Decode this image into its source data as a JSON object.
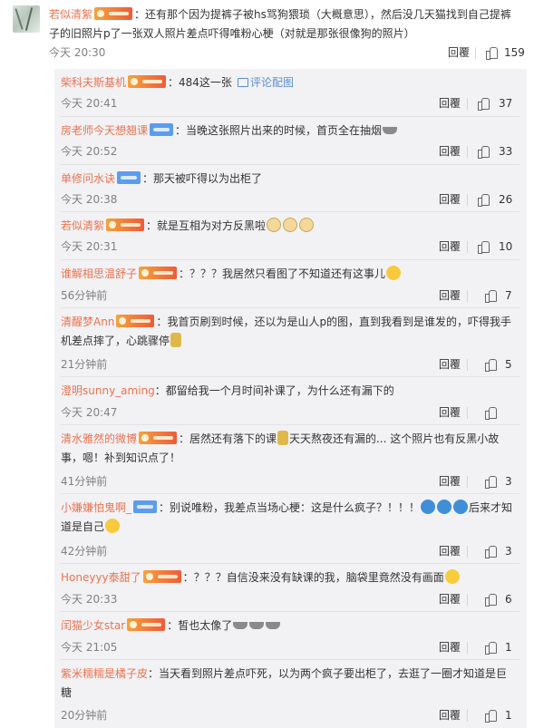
{
  "top_comment": {
    "user": "若似清絮",
    "colon": "：",
    "text": "还有那个因为提裤子被hs骂狗猥琐（大概意思），然后没几天猫找到自己提裤子的旧照片p了一张双人照片差点吓得唯粉心梗（对就是那张很像狗的照片）",
    "time": "今天 20:30",
    "reply_label": "回覆",
    "likes": "159"
  },
  "replies": [
    {
      "user": "柴科夫斯基机",
      "text": "484这一张",
      "extra_link": "评论配图",
      "time": "今天 20:41",
      "reply_label": "回覆",
      "likes": "37"
    },
    {
      "user": "房老师今天想翘课",
      "text": "当晚这张照片出来的时候，首页全在抽烟",
      "time": "今天 20:52",
      "reply_label": "回覆",
      "likes": "33"
    },
    {
      "user": "单修问水诀",
      "text": "那天被吓得以为出柜了",
      "time": "今天 20:38",
      "reply_label": "回覆",
      "likes": "26"
    },
    {
      "user": "若似清絮",
      "text": "就是互相为对方反黑啦",
      "time": "今天 20:31",
      "reply_label": "回覆",
      "likes": "10"
    },
    {
      "user": "谁解相思温舒子",
      "text": "？？？我居然只看图了不知道还有这事儿",
      "time": "56分钟前",
      "reply_label": "回覆",
      "likes": "7"
    },
    {
      "user": "清醒梦Ann",
      "text": "我首页刷到时候，还以为是山人p的图，直到我看到是谁发的，吓得我手机差点摔了，心跳骤停",
      "time": "21分钟前",
      "reply_label": "回覆",
      "likes": "5"
    },
    {
      "user": "澄明sunny_aming",
      "text": "都留给我一个月时间补课了，为什么还有漏下的",
      "time": "今天 20:47",
      "reply_label": "回覆",
      "likes": ""
    },
    {
      "user": "清水雅然的微博",
      "text": "居然还有落下的课",
      "text2": "天天熬夜还有漏的... 这个照片也有反黑小故事，嗯！补到知识点了！",
      "time": "41分钟前",
      "reply_label": "回覆",
      "likes": "3"
    },
    {
      "user": "小嫌嫌怕鬼啊_",
      "text": "别说唯粉，我差点当场心梗：这是什么疯子？！！！",
      "text2": "后来才知道是自己",
      "time": "42分钟前",
      "reply_label": "回覆",
      "likes": "3"
    },
    {
      "user": "Honeyyy泰甜了",
      "text": "？？？自信没来没有缺课的我，脑袋里竟然没有画面",
      "time": "今天 20:33",
      "reply_label": "回覆",
      "likes": "6"
    },
    {
      "user": "闰猫少女star",
      "text": "皙也太像了",
      "time": "今天 21:05",
      "reply_label": "回覆",
      "likes": "1"
    },
    {
      "user": "紫米糯糯是橘子皮",
      "text": "当天看到照片差点吓死，以为两个疯子要出柜了，去逛了一圈才知道是巨糖",
      "time": "20分钟前",
      "reply_label": "回覆",
      "likes": "1"
    }
  ]
}
